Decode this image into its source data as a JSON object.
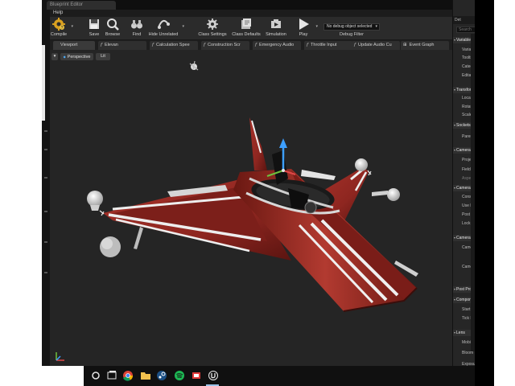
{
  "window": {
    "title": "Blueprint Editor"
  },
  "menubar": {
    "help": "Help"
  },
  "toolbar": {
    "compile": "Compile",
    "save": "Save",
    "browse": "Browse",
    "find": "Find",
    "hide_unrelated": "Hide Unrelated",
    "class_settings": "Class Settings",
    "class_defaults": "Class Defaults",
    "simulation": "Simulation",
    "play": "Play",
    "debug_object": "No debug object selected",
    "debug_filter": "Debug Filter"
  },
  "editor_tabs": [
    "Viewport",
    "Elevan",
    "Calculation Spee",
    "Construction Scr",
    "Emergency Audio",
    "Throttle Input",
    "Update Audio Cu",
    "Event Graph"
  ],
  "viewport": {
    "perspective": "Perspective",
    "lit": "Lit"
  },
  "details": {
    "title": "Det",
    "search_placeholder": "Search",
    "items": [
      {
        "kind": "cat",
        "label": "Variable"
      },
      {
        "kind": "prop",
        "label": "Variable Name"
      },
      {
        "kind": "prop",
        "label": "Tooltip"
      },
      {
        "kind": "prop",
        "label": "Category"
      },
      {
        "kind": "prop",
        "label": "Editable"
      },
      {
        "kind": "cat",
        "label": "Transform"
      },
      {
        "kind": "prop",
        "label": "Location"
      },
      {
        "kind": "prop",
        "label": "Rotation"
      },
      {
        "kind": "prop",
        "label": "Scale"
      },
      {
        "kind": "cat",
        "label": "Sockets"
      },
      {
        "kind": "prop",
        "label": "Parent Socket"
      },
      {
        "kind": "cat",
        "label": "Camera"
      },
      {
        "kind": "prop",
        "label": "Projection Mode"
      },
      {
        "kind": "prop",
        "label": "Field Of View"
      },
      {
        "kind": "prop",
        "label": "Aspect Ratio"
      },
      {
        "kind": "cat",
        "label": "Camera Settings"
      },
      {
        "kind": "prop",
        "label": "Constrain Aspect Ratio"
      },
      {
        "kind": "prop",
        "label": "Use Pawn Control Rotation"
      },
      {
        "kind": "prop",
        "label": "Post Process Blend Weight"
      },
      {
        "kind": "prop",
        "label": "Lock to HMD"
      },
      {
        "kind": "cat",
        "label": "Camera Options"
      },
      {
        "kind": "prop",
        "label": "Camera Lag"
      },
      {
        "kind": "prop",
        "label": "Camera Rotation Lag"
      },
      {
        "kind": "cat",
        "label": "Post Process"
      },
      {
        "kind": "cat",
        "label": "Component Tick"
      },
      {
        "kind": "prop",
        "label": "Start with Tick Enabled"
      },
      {
        "kind": "prop",
        "label": "Tick Interval"
      },
      {
        "kind": "cat",
        "label": "Lens"
      },
      {
        "kind": "prop",
        "label": "Mobile"
      },
      {
        "kind": "prop",
        "label": "Bloom"
      },
      {
        "kind": "prop",
        "label": "Exposure"
      }
    ]
  },
  "colors": {
    "hull": "#8e2620",
    "stripe": "#f2f2f2",
    "accent": "#3d9fff"
  }
}
